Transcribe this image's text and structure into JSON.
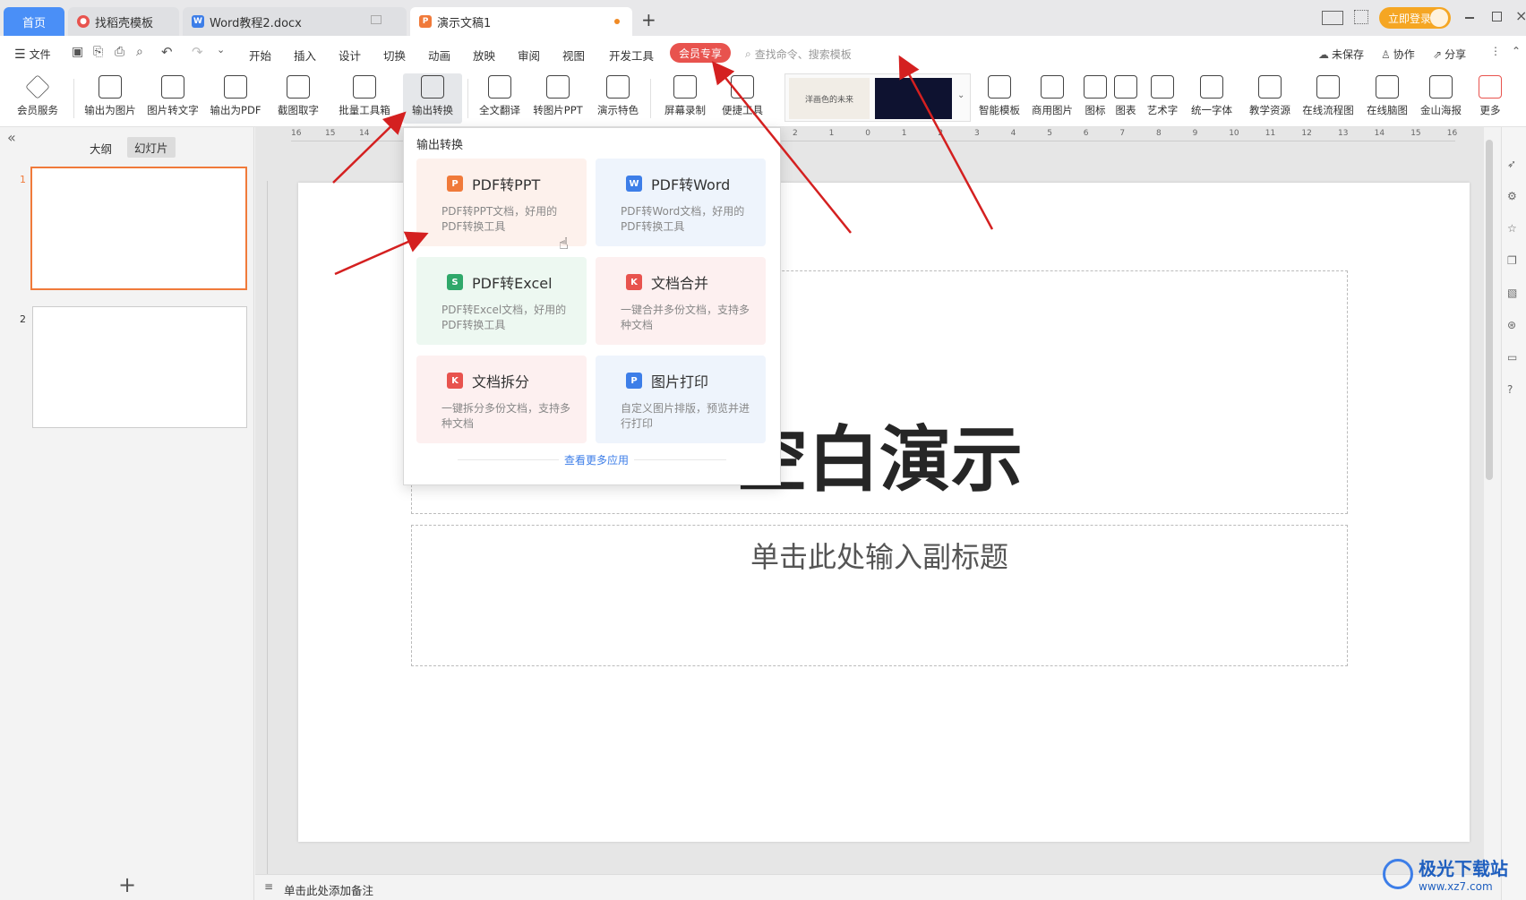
{
  "tabs": {
    "home": "首页",
    "t1": "找稻壳模板",
    "t2": "Word教程2.docx",
    "t3": "演示文稿1",
    "add": "+",
    "login": "立即登录"
  },
  "menu": {
    "file": "文件",
    "items": [
      "开始",
      "插入",
      "设计",
      "切换",
      "动画",
      "放映",
      "审阅",
      "视图",
      "开发工具"
    ],
    "member": "会员专享",
    "search_placeholder": "查找命令、搜索模板",
    "unsaved": "未保存",
    "collab": "协作",
    "share": "分享"
  },
  "ribbon": {
    "items": [
      "会员服务",
      "输出为图片",
      "图片转文字",
      "输出为PDF",
      "截图取字",
      "批量工具箱",
      "输出转换",
      "全文翻译",
      "转图片PPT",
      "演示特色",
      "屏幕录制",
      "便捷工具",
      "智能模板",
      "商用图片",
      "图标",
      "图表",
      "艺术字",
      "统一字体",
      "教学资源",
      "在线流程图",
      "在线脑图",
      "金山海报",
      "更多"
    ],
    "thumb1_text": "洋画色的未来"
  },
  "leftpanel": {
    "outline_tab": "大纲",
    "slides_tab": "幻灯片",
    "slide_numbers": [
      "1",
      "2"
    ],
    "add": "+"
  },
  "ruler": {
    "h_labels": [
      "16",
      "15",
      "14",
      "2",
      "1",
      "0",
      "1",
      "2",
      "3",
      "4",
      "5",
      "6",
      "7",
      "8",
      "9",
      "10",
      "11",
      "12",
      "13",
      "14",
      "15",
      "16"
    ]
  },
  "slide": {
    "title": "空白演示",
    "subtitle": "单击此处输入副标题"
  },
  "dropdown": {
    "header": "输出转换",
    "cards": [
      {
        "title": "PDF转PPT",
        "desc": "PDF转PPT文档，好用的PDF转换工具",
        "icon": "P",
        "color": "#f07a3a",
        "bg": "#fdf1ec"
      },
      {
        "title": "PDF转Word",
        "desc": "PDF转Word文档，好用的PDF转换工具",
        "icon": "W",
        "color": "#3d7ee8",
        "bg": "#eef4fc"
      },
      {
        "title": "PDF转Excel",
        "desc": "PDF转Excel文档，好用的PDF转换工具",
        "icon": "S",
        "color": "#2fa86a",
        "bg": "#edf8f1"
      },
      {
        "title": "文档合并",
        "desc": "一键合并多份文档，支持多种文档",
        "icon": "K",
        "color": "#e8534e",
        "bg": "#fdf0f0"
      },
      {
        "title": "文档拆分",
        "desc": "一键拆分多份文档，支持多种文档",
        "icon": "K",
        "color": "#e8534e",
        "bg": "#fdf0f0"
      },
      {
        "title": "图片打印",
        "desc": "自定义图片排版，预览并进行打印",
        "icon": "P",
        "color": "#3d7ee8",
        "bg": "#eef4fc"
      }
    ],
    "more": "查看更多应用"
  },
  "status": {
    "notes": "单击此处添加备注"
  },
  "watermark": {
    "name": "极光下载站",
    "url": "www.xz7.com"
  },
  "colors": {
    "accent": "#4a8ff7",
    "member": "#e8534e",
    "arrow": "#d42020",
    "selected_slide": "#f07a3a"
  }
}
